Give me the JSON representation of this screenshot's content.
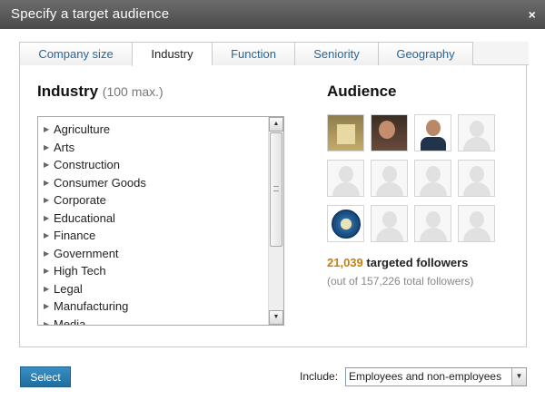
{
  "dialog": {
    "title": "Specify a target audience",
    "close_glyph": "×"
  },
  "tabs": [
    {
      "label": "Company size"
    },
    {
      "label": "Industry",
      "active": true
    },
    {
      "label": "Function"
    },
    {
      "label": "Seniority"
    },
    {
      "label": "Geography"
    }
  ],
  "industry": {
    "heading": "Industry",
    "max_note": "(100 max.)",
    "items": [
      "Agriculture",
      "Arts",
      "Construction",
      "Consumer Goods",
      "Corporate",
      "Educational",
      "Finance",
      "Government",
      "High Tech",
      "Legal",
      "Manufacturing",
      "Media"
    ]
  },
  "audience": {
    "heading": "Audience",
    "avatars": [
      "photo",
      "photo",
      "photo",
      "placeholder",
      "placeholder",
      "placeholder",
      "placeholder",
      "placeholder",
      "logo",
      "placeholder",
      "placeholder",
      "placeholder"
    ],
    "targeted_count": "21,039",
    "targeted_label": "targeted followers",
    "total_note": "(out of 157,226 total followers)"
  },
  "footer": {
    "select_label": "Select",
    "include_label": "Include:",
    "include_value": "Employees and non-employees"
  },
  "colors": {
    "accent": "#1f6d9f",
    "count": "#c97c12",
    "titlebar": "#4a4a4a"
  },
  "icons": {
    "list_arrow": "triangle-right",
    "scroll_up": "chevron-up",
    "scroll_down": "chevron-down",
    "dropdown": "chevron-down"
  }
}
